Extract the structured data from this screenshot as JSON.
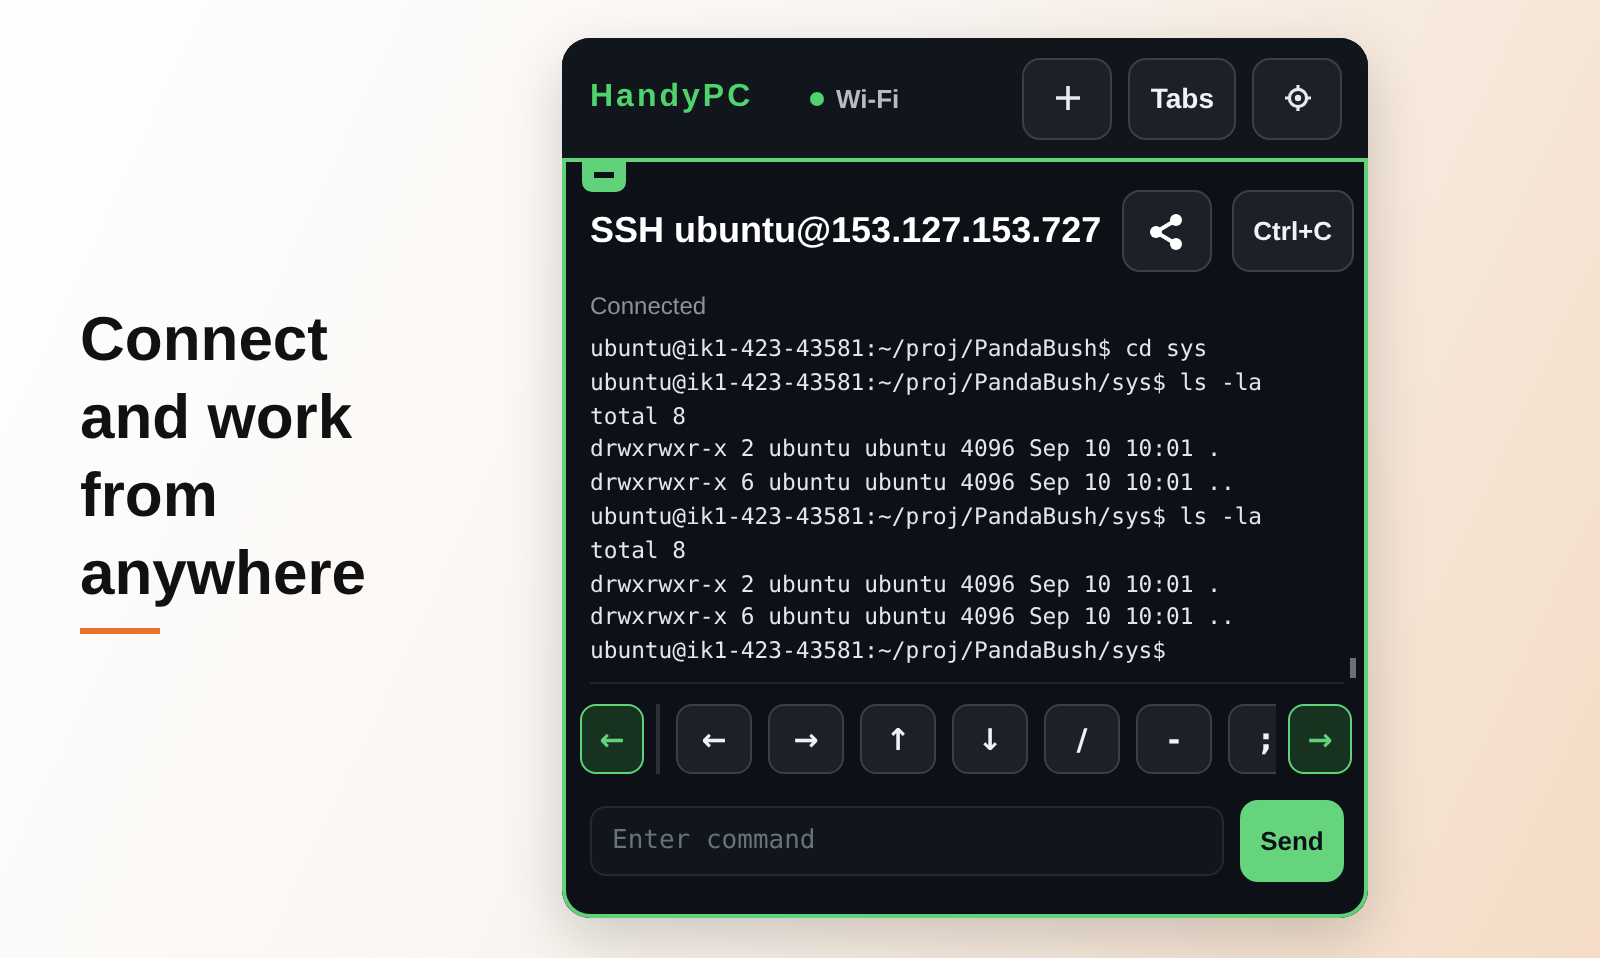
{
  "headline": "Connect and work from anywhere",
  "app": {
    "name": "HandyPC",
    "network": "Wi-Fi",
    "tabs_button": "Tabs"
  },
  "session": {
    "title": "SSH ubuntu@153.127.153.727",
    "copy_button": "Ctrl+C",
    "status": "Connected",
    "lines": [
      "ubuntu@ik1-423-43581:~/proj/PandaBush$ cd sys",
      "ubuntu@ik1-423-43581:~/proj/PandaBush/sys$ ls -la",
      "total 8",
      "drwxrwxr-x 2 ubuntu ubuntu 4096 Sep 10 10:01 .",
      "drwxrwxr-x 6 ubuntu ubuntu 4096 Sep 10 10:01 ..",
      "ubuntu@ik1-423-43581:~/proj/PandaBush/sys$ ls -la",
      "total 8",
      "drwxrwxr-x 2 ubuntu ubuntu 4096 Sep 10 10:01 .",
      "drwxrwxr-x 6 ubuntu ubuntu 4096 Sep 10 10:01 ..",
      "ubuntu@ik1-423-43581:~/proj/PandaBush/sys$"
    ]
  },
  "key_bar": {
    "scroll_left": "←",
    "keys": [
      "←",
      "→",
      "↑",
      "↓",
      "/",
      "-",
      ";"
    ],
    "scroll_right": "→"
  },
  "command": {
    "placeholder": "Enter command",
    "send": "Send"
  }
}
